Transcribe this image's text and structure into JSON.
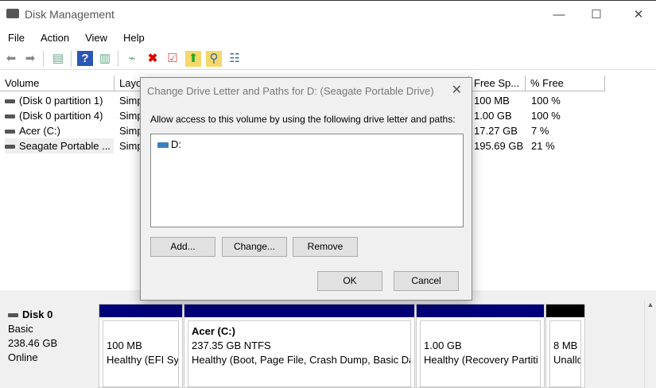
{
  "window": {
    "title": "Disk Management",
    "minimize": "—",
    "maximize": "☐",
    "close": "✕"
  },
  "menu": [
    "File",
    "Action",
    "View",
    "Help"
  ],
  "toolbar": {
    "icons": [
      "back-icon",
      "forward-icon",
      "console-tree-icon",
      "help-icon",
      "show-pane-icon",
      "connect-disk-icon",
      "delete-icon",
      "check-icon",
      "open-folder-icon",
      "explore-icon",
      "properties-icon"
    ]
  },
  "list": {
    "headers": [
      "Volume",
      "Layo",
      "Free Sp...",
      "% Free"
    ],
    "rows": [
      {
        "volume": "(Disk 0 partition 1)",
        "layout": "Simp",
        "free": "100 MB",
        "pct": "100 %"
      },
      {
        "volume": "(Disk 0 partition 4)",
        "layout": "Simp",
        "free": "1.00 GB",
        "pct": "100 %"
      },
      {
        "volume": "Acer (C:)",
        "layout": "Simp",
        "free": "17.27 GB",
        "pct": "7 %"
      },
      {
        "volume": "Seagate Portable ...",
        "layout": "Simp",
        "free": "195.69 GB",
        "pct": "21 %"
      }
    ]
  },
  "disk": {
    "name": "Disk 0",
    "type": "Basic",
    "size": "238.46 GB",
    "status": "Online",
    "partitions": [
      {
        "title": "",
        "size": "100 MB",
        "status": "Healthy (EFI Sys"
      },
      {
        "title": "Acer  (C:)",
        "size": "237.35 GB NTFS",
        "status": "Healthy (Boot, Page File, Crash Dump, Basic Da"
      },
      {
        "title": "",
        "size": "1.00 GB",
        "status": "Healthy (Recovery Partiti"
      },
      {
        "title": "",
        "size": "8 MB",
        "status": "Unallc"
      }
    ]
  },
  "dialog": {
    "title": "Change Drive Letter and Paths for D: (Seagate Portable Drive)",
    "label": "Allow access to this volume by using the following drive letter and paths:",
    "paths": [
      "D:"
    ],
    "add": "Add...",
    "change": "Change...",
    "remove": "Remove",
    "ok": "OK",
    "cancel": "Cancel"
  }
}
